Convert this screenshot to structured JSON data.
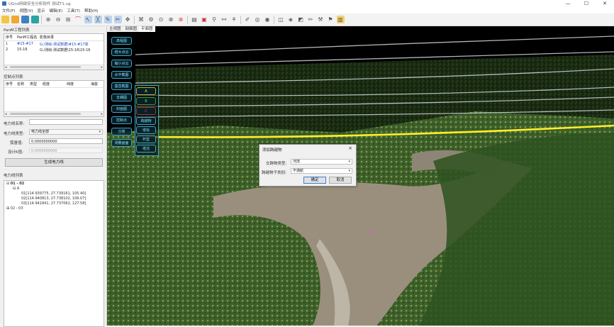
{
  "window": {
    "title": "UGnd网络安全分析软件 测试T1.ug",
    "minimize": "—",
    "maximize": "☐",
    "close": "✕"
  },
  "menu": [
    "文件(F)",
    "视图(V)",
    "显示",
    "编辑(E)",
    "工具(T)",
    "帮助(H)"
  ],
  "toolbar_icons": [
    "folder-new-icon",
    "folder-open-icon",
    "save-icon",
    "export-icon",
    "zoom-in-icon",
    "zoom-out-icon",
    "zoom-fit-icon",
    "measure-icon",
    "select-icon",
    "line-icon",
    "edit-icon",
    "cut-icon",
    "move-icon",
    "network-icon",
    "settings-icon",
    "node-icon",
    "delete-icon",
    "add-icon",
    "file-icon",
    "tower-icon",
    "link-icon",
    "connector-icon",
    "pen-icon",
    "draw-icon",
    "eye-icon",
    "refresh-icon",
    "mirror-icon",
    "layers-icon",
    "ruler-icon",
    "pencil-icon",
    "tools-icon",
    "antenna-icon",
    "report-icon"
  ],
  "project_list": {
    "title": "PanM工程列表",
    "columns": [
      "序号",
      "PanM工程名",
      "影像目录"
    ],
    "rows": [
      [
        "1",
        "#15-#17",
        "G:/测绘-测试数据\\#15-#17高"
      ],
      [
        "2",
        "15-16",
        "G:/测绘-测试数据\\15-16\\15-16"
      ]
    ]
  },
  "control_points": {
    "title": "控制点列表",
    "columns": [
      "序号",
      "名称",
      "类型",
      "经度",
      "纬度",
      "海拔"
    ],
    "rows": []
  },
  "form": {
    "line_name_label": "电力线名称:",
    "line_name_value": "",
    "line_type_label": "电力线类型:",
    "line_type_value": "电力线全部",
    "sag_label": "弧垂值:",
    "sag_value": "0.0000000000",
    "design_label": "设计K值:",
    "design_value": "0.0000000000",
    "generate_button": "生成电力线"
  },
  "powerline_list": {
    "title": "电力线列表",
    "nodes": [
      {
        "label": "01 - 02",
        "level": 0,
        "expander": "⊟"
      },
      {
        "label": "A",
        "level": 1,
        "expander": "⊟"
      },
      {
        "label": "01[114.939775, 27.739161, 105.40]",
        "level": 2
      },
      {
        "label": "02[114.940813, 27.738102, 106.07]",
        "level": 2
      },
      {
        "label": "03[114.941841, 27.737062, 127.58]",
        "level": 2
      },
      {
        "label": "02 - 03",
        "level": 0,
        "expander": "⊞"
      }
    ]
  },
  "view_tabs": [
    "主视图",
    "剖面图",
    "平面图"
  ],
  "side_buttons": [
    "高程图",
    "增大点云",
    "缩小点云",
    "水平截图",
    "垂直截图",
    "去耦图",
    "封面图",
    "控制点",
    "分类",
    "测量画面"
  ],
  "phase_buttons": [
    "A",
    "B",
    "C",
    "跨越物",
    "塔标",
    "杆型",
    "塔洁"
  ],
  "dialog": {
    "title": "添加跨越物",
    "close": "×",
    "type_label": "交跨物类型:",
    "type_value": "河流",
    "subtype_label": "跨越物子类别:",
    "subtype_value": "不通航",
    "ok": "确定",
    "cancel": "取消"
  }
}
